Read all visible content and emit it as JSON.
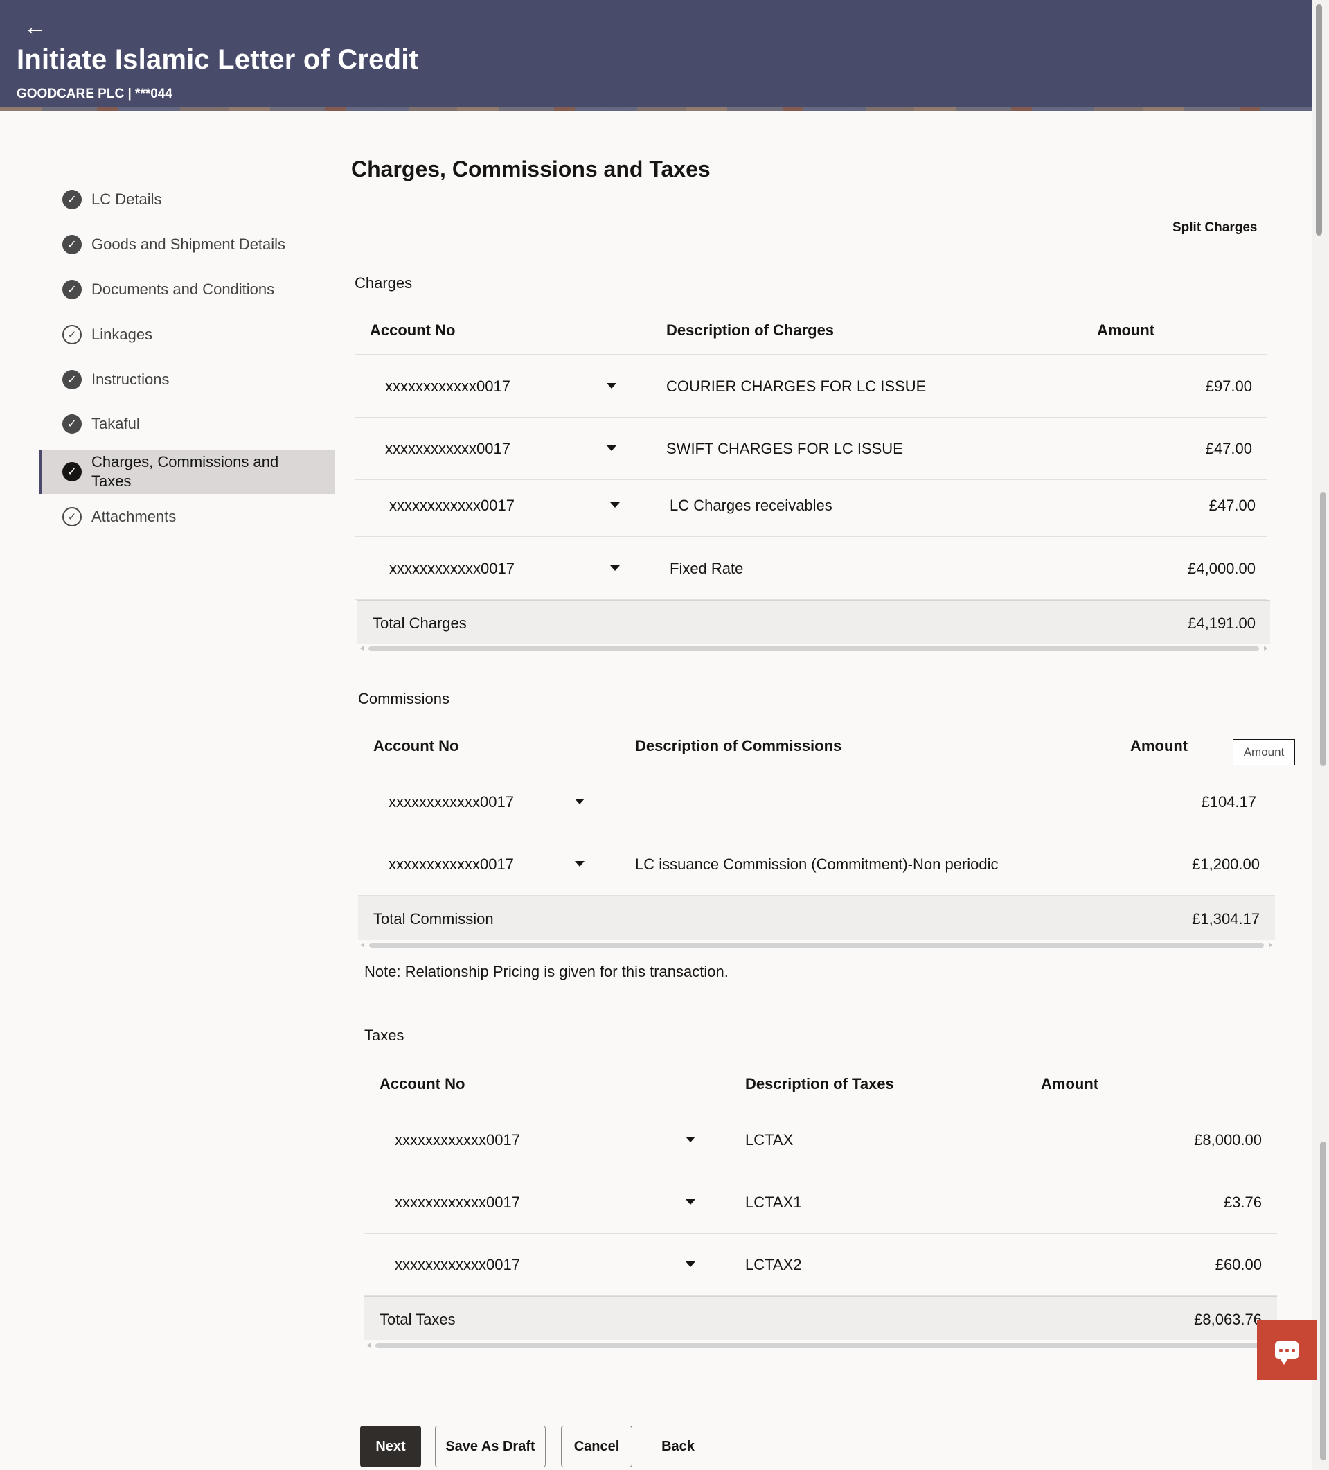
{
  "header": {
    "back_icon": "←",
    "title": "Initiate Islamic Letter of Credit",
    "subtitle": "GOODCARE PLC | ***044"
  },
  "nav": {
    "items": [
      {
        "label": "LC Details",
        "state": "complete"
      },
      {
        "label": "Goods and Shipment Details",
        "state": "complete"
      },
      {
        "label": "Documents and Conditions",
        "state": "complete"
      },
      {
        "label": "Linkages",
        "state": "outline"
      },
      {
        "label": "Instructions",
        "state": "complete"
      },
      {
        "label": "Takaful",
        "state": "complete"
      },
      {
        "label": "Charges, Commissions and Taxes",
        "state": "active"
      },
      {
        "label": "Attachments",
        "state": "outline"
      }
    ],
    "check_glyph": "✓"
  },
  "main": {
    "title": "Charges, Commissions and Taxes",
    "split_charges": "Split Charges"
  },
  "charges": {
    "label": "Charges",
    "headers": {
      "account": "Account No",
      "description": "Description of Charges",
      "amount": "Amount"
    },
    "rows": [
      {
        "account": "xxxxxxxxxxxx0017",
        "description": "COURIER CHARGES FOR LC ISSUE",
        "amount": "£97.00"
      },
      {
        "account": "xxxxxxxxxxxx0017",
        "description": "SWIFT CHARGES FOR LC ISSUE",
        "amount": "£47.00"
      },
      {
        "account": "xxxxxxxxxxxx0017",
        "description": "LC Charges receivables",
        "amount": "£47.00"
      },
      {
        "account": "xxxxxxxxxxxx0017",
        "description": "Fixed Rate",
        "amount": "£4,000.00"
      }
    ],
    "total_label": "Total Charges",
    "total_value": "£4,191.00"
  },
  "commissions": {
    "label": "Commissions",
    "headers": {
      "account": "Account No",
      "description": "Description of Commissions",
      "amount": "Amount"
    },
    "tooltip": "Amount",
    "rows": [
      {
        "account": "xxxxxxxxxxxx0017",
        "description": "",
        "amount": "£104.17"
      },
      {
        "account": "xxxxxxxxxxxx0017",
        "description": "LC issuance Commission (Commitment)-Non periodic",
        "amount": "£1,200.00"
      }
    ],
    "total_label": "Total Commission",
    "total_value": "£1,304.17"
  },
  "note": "Note: Relationship Pricing is given for this transaction.",
  "taxes": {
    "label": "Taxes",
    "headers": {
      "account": "Account No",
      "description": "Description of Taxes",
      "amount": "Amount"
    },
    "rows": [
      {
        "account": "xxxxxxxxxxxx0017",
        "description": "LCTAX",
        "amount": "£8,000.00"
      },
      {
        "account": "xxxxxxxxxxxx0017",
        "description": "LCTAX1",
        "amount": "£3.76"
      },
      {
        "account": "xxxxxxxxxxxx0017",
        "description": "LCTAX2",
        "amount": "£60.00"
      }
    ],
    "total_label": "Total Taxes",
    "total_value": "£8,063.76"
  },
  "buttons": {
    "next": "Next",
    "save_draft": "Save As Draft",
    "cancel": "Cancel",
    "back": "Back"
  },
  "colors": {
    "header_bg": "#484b6a",
    "chat_bg": "#c74634",
    "primary_btn": "#312d2a"
  },
  "icons": {
    "chat": "chat-bubble-icon"
  }
}
